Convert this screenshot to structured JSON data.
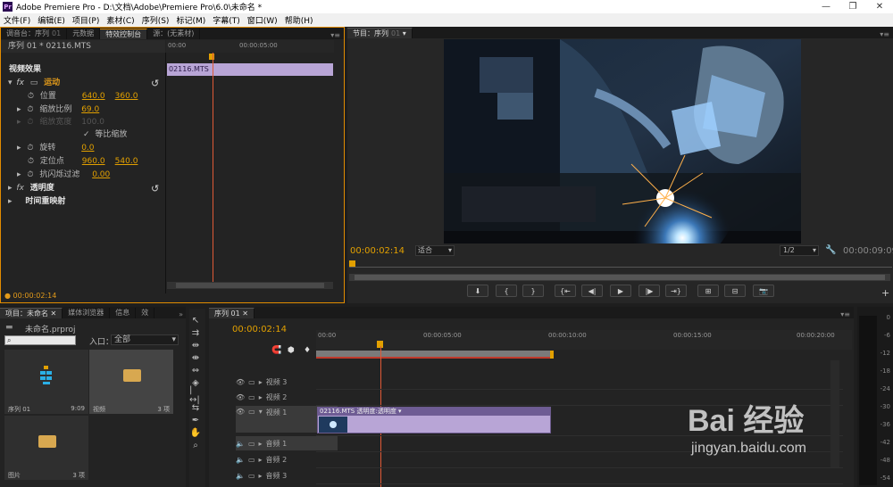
{
  "window": {
    "title": "Adobe Premiere Pro - D:\\文档\\Adobe\\Premiere Pro\\6.0\\未命名 *",
    "logo": "Pr",
    "controls": {
      "minimize": "—",
      "maximize": "❐",
      "close": "✕"
    }
  },
  "menu": [
    "文件(F)",
    "编辑(E)",
    "项目(P)",
    "素材(C)",
    "序列(S)",
    "标记(M)",
    "字幕(T)",
    "窗口(W)",
    "帮助(H)"
  ],
  "source_panel": {
    "tabs": [
      {
        "label": "调音台：序列",
        "sub": "01"
      },
      {
        "label": "元数据",
        "sub": ""
      },
      {
        "label": "特效控制台",
        "sub": ""
      },
      {
        "label": "源：(无素材)",
        "sub": ""
      }
    ],
    "clip_header": "序列 01 * 02116.MTS",
    "mini_timeline": {
      "t0": "00:00",
      "t1": "00:00:05:00",
      "clip_name": "02116.MTS"
    },
    "section_title": "视频效果",
    "motion": {
      "label": "运动",
      "position_label": "位置",
      "position_x": "640.0",
      "position_y": "360.0",
      "scale_label": "缩放比例",
      "scale_value": "69.0",
      "scale_width_label": "缩放宽度",
      "scale_width_value": "100.0",
      "uniform_label": "等比缩放",
      "rotation_label": "旋转",
      "rotation_value": "0.0",
      "anchor_label": "定位点",
      "anchor_x": "960.0",
      "anchor_y": "540.0",
      "antiflicker_label": "抗闪烁过滤",
      "antiflicker_value": "0.00"
    },
    "opacity_label": "透明度",
    "time_remap_label": "时间重映射",
    "timecode": "00:00:02:14"
  },
  "program_monitor": {
    "tab_label": "节目：序列",
    "tab_sub": "01",
    "timecode": "00:00:02:14",
    "fit_label": "适合",
    "resolution": "1/2",
    "duration": "00:00:09:09",
    "buttons": [
      "marker-button",
      "in-point-button",
      "out-point-button",
      "go-to-in-button",
      "step-back-button",
      "play-button",
      "step-forward-button",
      "go-to-out-button",
      "lift-button",
      "extract-button",
      "export-frame-button"
    ]
  },
  "project_panel": {
    "tabs": [
      {
        "label": "项目：未命名"
      },
      {
        "label": "媒体浏览器"
      },
      {
        "label": "信息"
      },
      {
        "label": "效"
      }
    ],
    "project_file": "未命名.prproj",
    "item_count": "3 项",
    "search_placeholder": "",
    "inlet_label": "入口：",
    "inlet_value": "全部",
    "items": [
      {
        "name": "序列 01",
        "meta": "9:09",
        "type": "sequence"
      },
      {
        "name": "视频",
        "meta": "3 项",
        "type": "folder"
      },
      {
        "name": "图片",
        "meta": "3 项",
        "type": "folder"
      }
    ]
  },
  "timeline": {
    "tab_label": "序列 01",
    "timecode": "00:00:02:14",
    "ruler": [
      "00:00",
      "00:00:05:00",
      "00:00:10:00",
      "00:00:15:00",
      "00:00:20:00"
    ],
    "tracks": [
      {
        "name": "视频 3",
        "kind": "video"
      },
      {
        "name": "视频 2",
        "kind": "video"
      },
      {
        "name": "视频 1",
        "kind": "video"
      },
      {
        "name": "音频 1",
        "kind": "audio"
      },
      {
        "name": "音频 2",
        "kind": "audio"
      },
      {
        "name": "音频 3",
        "kind": "audio"
      }
    ],
    "clip_label": "02116.MTS  透明度:透明度 ▾"
  },
  "audio_meter": {
    "ticks": [
      "0",
      "-6",
      "-12",
      "-18",
      "-24",
      "-30",
      "-36",
      "-42",
      "-48",
      "-54"
    ]
  },
  "watermark": {
    "brand": "Bai 经验",
    "url": "jingyan.baidu.com"
  },
  "colors": {
    "accent": "#e29a1a",
    "clip": "#b8a5d6",
    "playhead": "#e05a36"
  }
}
